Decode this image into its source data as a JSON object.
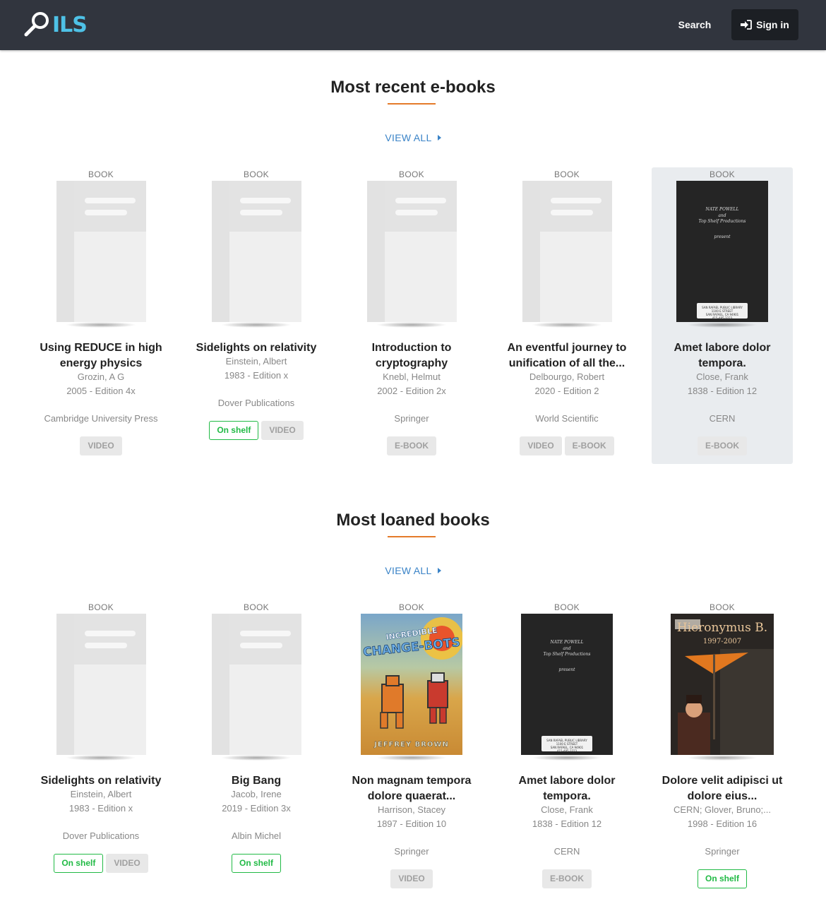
{
  "header": {
    "logo_text": "ILS",
    "search_label": "Search",
    "signin_label": "Sign in"
  },
  "sections": [
    {
      "title": "Most recent e-books",
      "view_all": "VIEW ALL",
      "cards": [
        {
          "type": "BOOK",
          "cover": "placeholder",
          "title": "Using REDUCE in high energy physics",
          "authors": "Grozin, A G",
          "year_edition": "2005 - Edition 4x",
          "publisher": "Cambridge University Press",
          "tags": [
            {
              "label": "VIDEO",
              "style": "grey"
            }
          ]
        },
        {
          "type": "BOOK",
          "cover": "placeholder",
          "title": "Sidelights on relativity",
          "authors": "Einstein, Albert",
          "year_edition": "1983 - Edition x",
          "publisher": "Dover Publications",
          "tags": [
            {
              "label": "On shelf",
              "style": "shelf"
            },
            {
              "label": "VIDEO",
              "style": "grey"
            }
          ]
        },
        {
          "type": "BOOK",
          "cover": "placeholder",
          "title": "Introduction to cryptography",
          "authors": "Knebl, Helmut",
          "year_edition": "2002 - Edition 2x",
          "publisher": "Springer",
          "tags": [
            {
              "label": "E-BOOK",
              "style": "grey"
            }
          ]
        },
        {
          "type": "BOOK",
          "cover": "placeholder",
          "title": "An eventful journey to unification of all the...",
          "authors": "Delbourgo, Robert",
          "year_edition": "2020 - Edition 2",
          "publisher": "World Scientific",
          "tags": [
            {
              "label": "VIDEO",
              "style": "grey"
            },
            {
              "label": "E-BOOK",
              "style": "grey"
            }
          ]
        },
        {
          "type": "BOOK",
          "cover": "notebook",
          "title": "Amet labore dolor tempora.",
          "authors": "Close, Frank",
          "year_edition": "1838 - Edition 12",
          "publisher": "CERN",
          "tags": [
            {
              "label": "E-BOOK",
              "style": "grey"
            }
          ],
          "highlighted": true
        }
      ]
    },
    {
      "title": "Most loaned books",
      "view_all": "VIEW ALL",
      "cards": [
        {
          "type": "BOOK",
          "cover": "placeholder",
          "title": "Sidelights on relativity",
          "authors": "Einstein, Albert",
          "year_edition": "1983 - Edition x",
          "publisher": "Dover Publications",
          "tags": [
            {
              "label": "On shelf",
              "style": "shelf"
            },
            {
              "label": "VIDEO",
              "style": "grey"
            }
          ]
        },
        {
          "type": "BOOK",
          "cover": "placeholder",
          "title": "Big Bang",
          "authors": "Jacob, Irene",
          "year_edition": "2019 - Edition 3x",
          "publisher": "Albin Michel",
          "tags": [
            {
              "label": "On shelf",
              "style": "shelf"
            }
          ]
        },
        {
          "type": "BOOK",
          "cover": "comic",
          "title": "Non magnam tempora dolore quaerat...",
          "authors": "Harrison, Stacey",
          "year_edition": "1897 - Edition 10",
          "publisher": "Springer",
          "tags": [
            {
              "label": "VIDEO",
              "style": "grey"
            }
          ],
          "cover_text": {
            "line1": "INCREDIBLE",
            "line2": "CHANGE-BOTS",
            "author": "JEFFREY BROWN"
          }
        },
        {
          "type": "BOOK",
          "cover": "notebook",
          "title": "Amet labore dolor tempora.",
          "authors": "Close, Frank",
          "year_edition": "1838 - Edition 12",
          "publisher": "CERN",
          "tags": [
            {
              "label": "E-BOOK",
              "style": "grey"
            }
          ]
        },
        {
          "type": "BOOK",
          "cover": "painting",
          "title": "Dolore velit adipisci ut dolore eius...",
          "authors": "CERN; Glover, Bruno;...",
          "year_edition": "1998 - Edition 16",
          "publisher": "Springer",
          "tags": [
            {
              "label": "On shelf",
              "style": "shelf"
            }
          ],
          "cover_text": {
            "title": "Hieronymus B.",
            "years": "1997-2007"
          }
        }
      ]
    }
  ],
  "notebook_cover": {
    "line1": "NATE POWELL",
    "line2": "and",
    "line3": "Top Shelf Productions",
    "line4": "present",
    "label_lines": [
      "SAN RAFAEL PUBLIC LIBRARY",
      "1100 E STREET",
      "SAN RAFAEL, CA 94901",
      "415-485-3323"
    ]
  },
  "colors": {
    "header_bg": "#31353e",
    "logo": "#4ec1e6",
    "accent_underline": "#e47b2a",
    "link": "#3a83c7",
    "on_shelf": "#21ba45"
  }
}
